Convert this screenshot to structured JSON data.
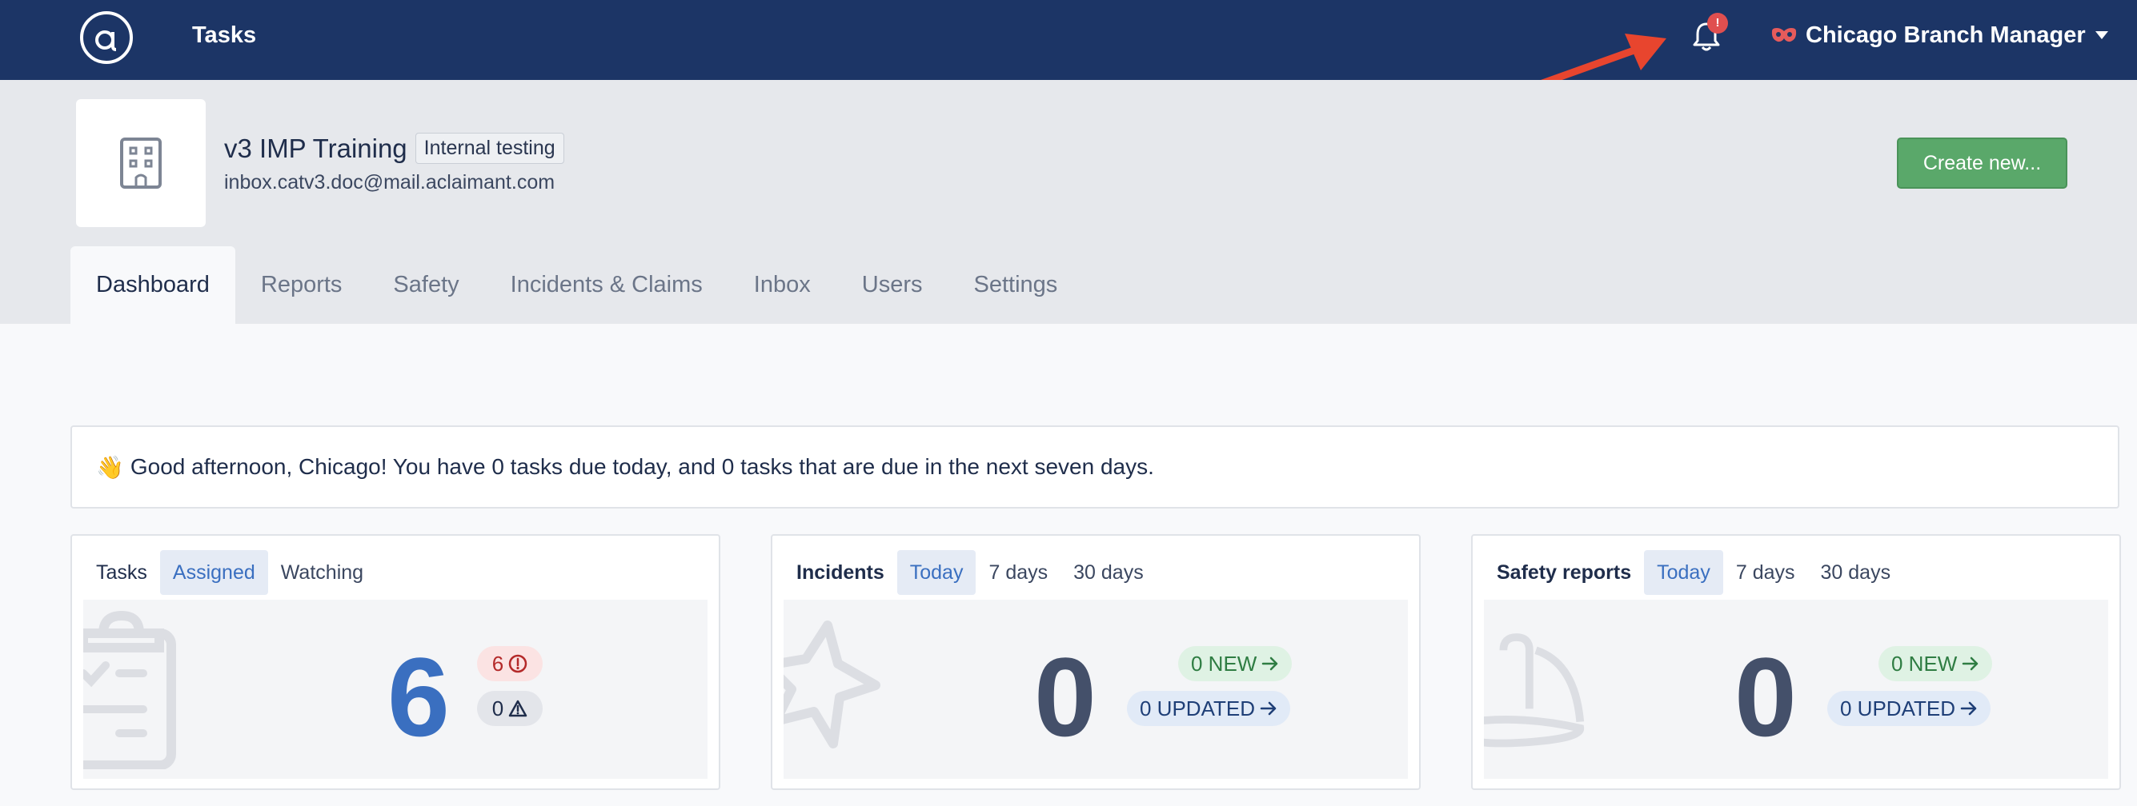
{
  "topbar": {
    "title": "Tasks",
    "notification_count": "!",
    "user_name": "Chicago Branch Manager"
  },
  "org": {
    "name": "v3 IMP Training",
    "tag": "Internal testing",
    "email": "inbox.catv3.doc@mail.aclaimant.com",
    "create_label": "Create new..."
  },
  "tabs": [
    {
      "label": "Dashboard",
      "active": true
    },
    {
      "label": "Reports"
    },
    {
      "label": "Safety"
    },
    {
      "label": "Incidents & Claims"
    },
    {
      "label": "Inbox"
    },
    {
      "label": "Users"
    },
    {
      "label": "Settings"
    }
  ],
  "greeting": {
    "emoji": "👋",
    "text": "Good afternoon, Chicago! You have 0 tasks due today, and 0 tasks that are due in the next seven days."
  },
  "cards": {
    "tasks": {
      "title": "Tasks",
      "tabs": [
        "Assigned",
        "Watching"
      ],
      "selected_tab": "Assigned",
      "count": "6",
      "overdue": "6",
      "warning": "0"
    },
    "incidents": {
      "title": "Incidents",
      "tabs": [
        "Today",
        "7 days",
        "30 days"
      ],
      "selected_tab": "Today",
      "count": "0",
      "new_label": "0 NEW",
      "updated_label": "0 UPDATED"
    },
    "safety": {
      "title": "Safety reports",
      "tabs": [
        "Today",
        "7 days",
        "30 days"
      ],
      "selected_tab": "Today",
      "count": "0",
      "new_label": "0 NEW",
      "updated_label": "0 UPDATED"
    }
  },
  "colors": {
    "navbar": "#1c3566",
    "primary_button": "#5aa86a",
    "tasks_number": "#3a6fc0",
    "count_number": "#44506a",
    "badge": "#e04f4f"
  }
}
